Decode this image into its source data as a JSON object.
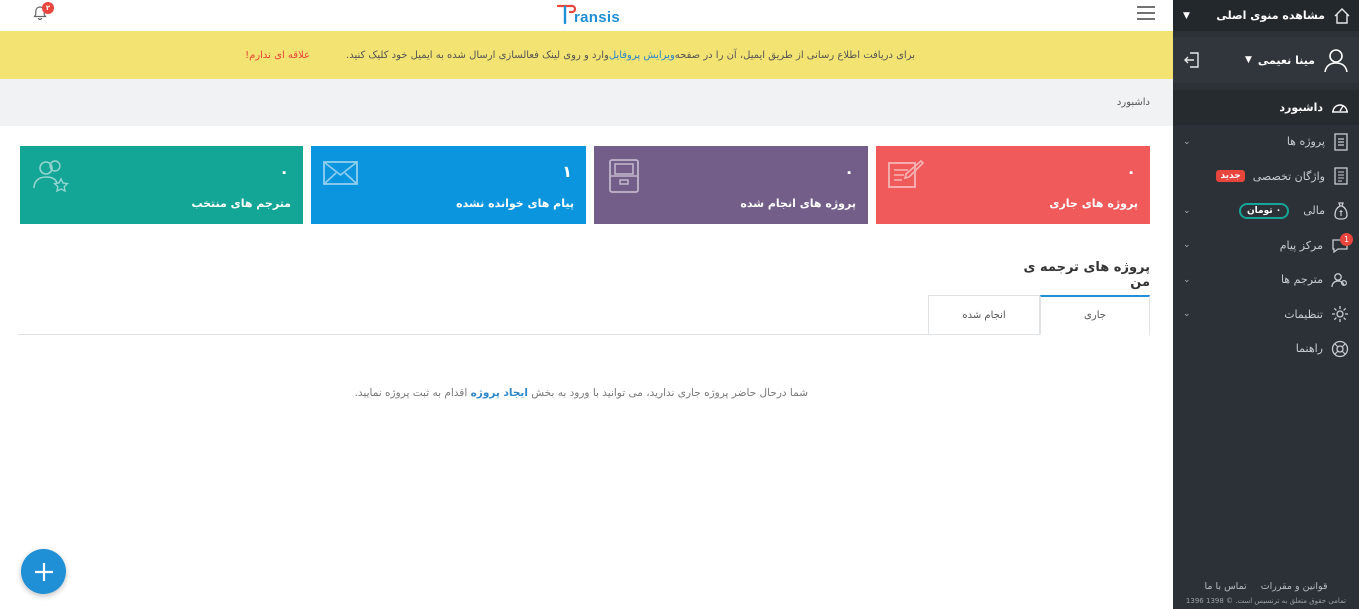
{
  "topbar": {
    "brand": "ransis",
    "notification_count": "۲"
  },
  "alert": {
    "text_before": "برای دریافت اطلاع رسانی از طریق ایمیل، آن را در صفحه ",
    "link": "ویرایش پروفایل",
    "text_after": " وارد و روی لینک فعالسازی ارسال شده به ایمیل خود کلیک کنید.",
    "optout": "علاقه ای ندارم!"
  },
  "breadcrumb": "داشبورد",
  "tiles": [
    {
      "value": "۰",
      "label": "پروژه های جاری",
      "color": "#f05a5b",
      "icon": "edit-icon"
    },
    {
      "value": "۰",
      "label": "پروژه های انجام شده",
      "color": "#735e8a",
      "icon": "archive-icon"
    },
    {
      "value": "۱",
      "label": "پیام های خوانده نشده",
      "color": "#0b95df",
      "icon": "mail-icon"
    },
    {
      "value": "۰",
      "label": "مترجم های منتخب",
      "color": "#13a596",
      "icon": "users-star-icon"
    }
  ],
  "projects": {
    "title": "پروژه های ترجمه ی من",
    "tabs": [
      "جاری",
      "انجام شده"
    ],
    "empty_before": "شما درحال حاضر پروژه جاری ندارید، می توانید با ورود به بخش ",
    "empty_link": "ایجاد پروژه",
    "empty_after": " اقدام به ثبت پروژه نمایید."
  },
  "sidebar": {
    "main_menu": "مشاهده منوی اصلی",
    "user_name": "مینا نعیمی",
    "items": [
      {
        "label": "داشبورد"
      },
      {
        "label": "پروژه ها"
      },
      {
        "label": "واژگان تخصصی",
        "badge": "جدید"
      },
      {
        "label": "مالی",
        "money": "۰ تومان"
      },
      {
        "label": "مرکز پیام",
        "count": "1"
      },
      {
        "label": "مترجم ها"
      },
      {
        "label": "تنظیمات"
      },
      {
        "label": "راهنما"
      }
    ],
    "footer_rules": "قوانین و مقررات",
    "footer_contact": "تماس با ما",
    "footer_copy": "تمامی حقوق متعلق به ترنسیس است. © 1398 1396"
  },
  "colors": {
    "accent": "#1f8fd6",
    "sidebar": "#2b3137",
    "alert_bg": "#f2e372"
  }
}
